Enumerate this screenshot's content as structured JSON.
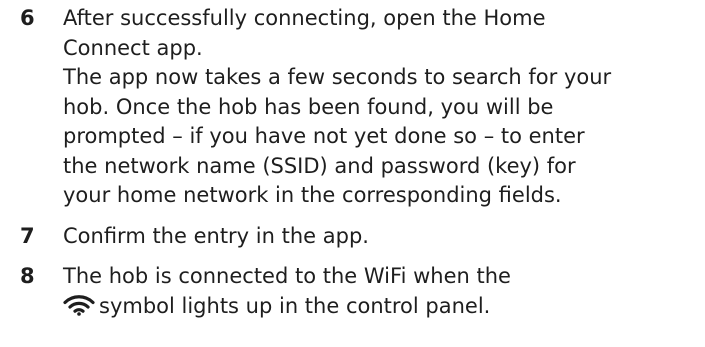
{
  "steps": [
    {
      "number": "6",
      "lines": [
        "After successfully connecting, open the Home",
        "Connect app.",
        "The app now takes a few seconds to search for your",
        "hob. Once the hob has been found, you will be",
        "prompted – if you have not yet done so – to enter",
        "the network name (SSID) and password (key) for",
        "your home network in the corresponding fields."
      ]
    },
    {
      "number": "7",
      "lines": [
        "Confirm the entry in the app."
      ]
    },
    {
      "number": "8",
      "lines": [
        "The hob is connected to the WiFi when the",
        "symbol lights up in the control panel."
      ],
      "icon": "wifi-icon"
    }
  ]
}
